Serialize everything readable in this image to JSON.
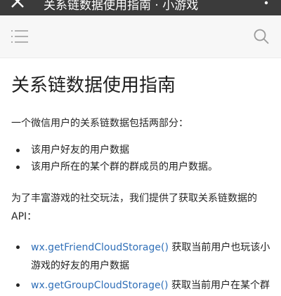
{
  "titlebar": {
    "title": "关系链数据使用指南 · 小游戏"
  },
  "toolbar": {
    "menu_icon": "hamburger-menu-icon",
    "search_icon": "search-icon"
  },
  "article": {
    "heading": "关系链数据使用指南",
    "intro": "一个微信用户的关系链数据包括两部分：",
    "parts": [
      "该用户好友的用户数据",
      "该用户所在的某个群的群成员的用户数据。"
    ],
    "api_intro": "为了丰富游戏的社交玩法，我们提供了获取关系链数据的API：",
    "apis": [
      {
        "name": "wx.getFriendCloudStorage()",
        "desc": " 获取当前用户也玩该小游戏的好友的用户数据"
      },
      {
        "name": "wx.getGroupCloudStorage()",
        "desc": " 获取当前用户在某个群"
      }
    ]
  }
}
